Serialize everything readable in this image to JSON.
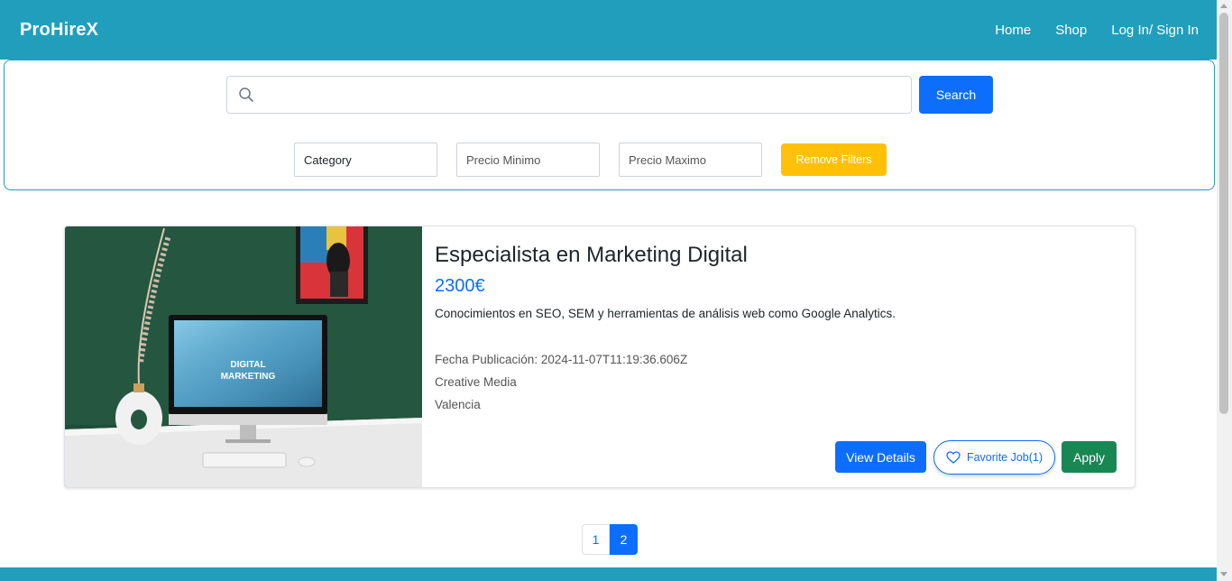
{
  "navbar": {
    "brand": "ProHireX",
    "links": [
      "Home",
      "Shop",
      "Log In/ Sign In"
    ]
  },
  "search": {
    "placeholder": "",
    "button_label": "Search",
    "filters": {
      "category": "Category",
      "min_price": "Precio Minimo",
      "max_price": "Precio Maximo"
    },
    "remove_label": "Remove Filters"
  },
  "job": {
    "image_text_line1": "DIGITAL",
    "image_text_line2": "MARKETING",
    "title": "Especialista en Marketing Digital",
    "salary": "2300€",
    "description": "Conocimientos en SEO, SEM y herramientas de análisis web como Google Analytics.",
    "date": "Fecha Publicación: 2024-11-07T11:19:36.606Z",
    "company": "Creative Media",
    "city": "Valencia",
    "view_label": "View Details",
    "favorite_label": "Favorite Job(1)",
    "apply_label": "Apply"
  },
  "pagination": {
    "pages": [
      "1",
      "2"
    ],
    "active": "2"
  },
  "colors": {
    "brand": "#219ebc",
    "primary": "#0d6efd",
    "warning": "#ffc107",
    "success": "#198754"
  }
}
